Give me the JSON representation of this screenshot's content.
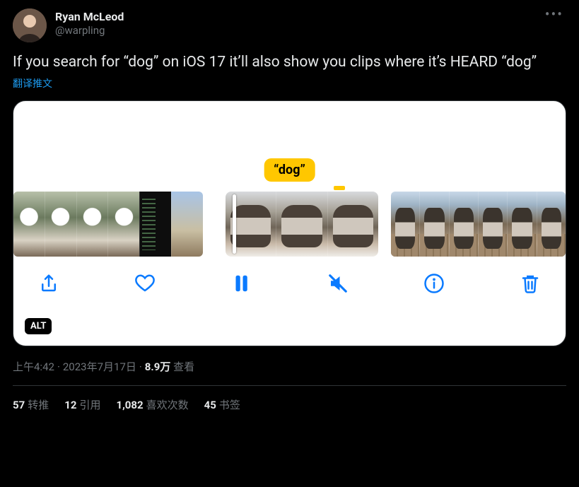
{
  "author": {
    "display_name": "Ryan McLeod",
    "handle": "@warpling"
  },
  "body": "If you search for “dog” on iOS 17 it’ll also show you clips where it’s HEARD “dog”",
  "translate_label": "翻译推文",
  "media": {
    "search_label": "“dog”",
    "alt_badge": "ALT"
  },
  "meta": {
    "time": "上午4:42",
    "date": "2023年7月17日",
    "views_count": "8.9万",
    "views_label": "查看"
  },
  "stats": {
    "retweets": {
      "n": "57",
      "label": "转推"
    },
    "quotes": {
      "n": "12",
      "label": "引用"
    },
    "likes": {
      "n": "1,082",
      "label": "喜欢次数"
    },
    "bookmarks": {
      "n": "45",
      "label": "书签"
    }
  }
}
